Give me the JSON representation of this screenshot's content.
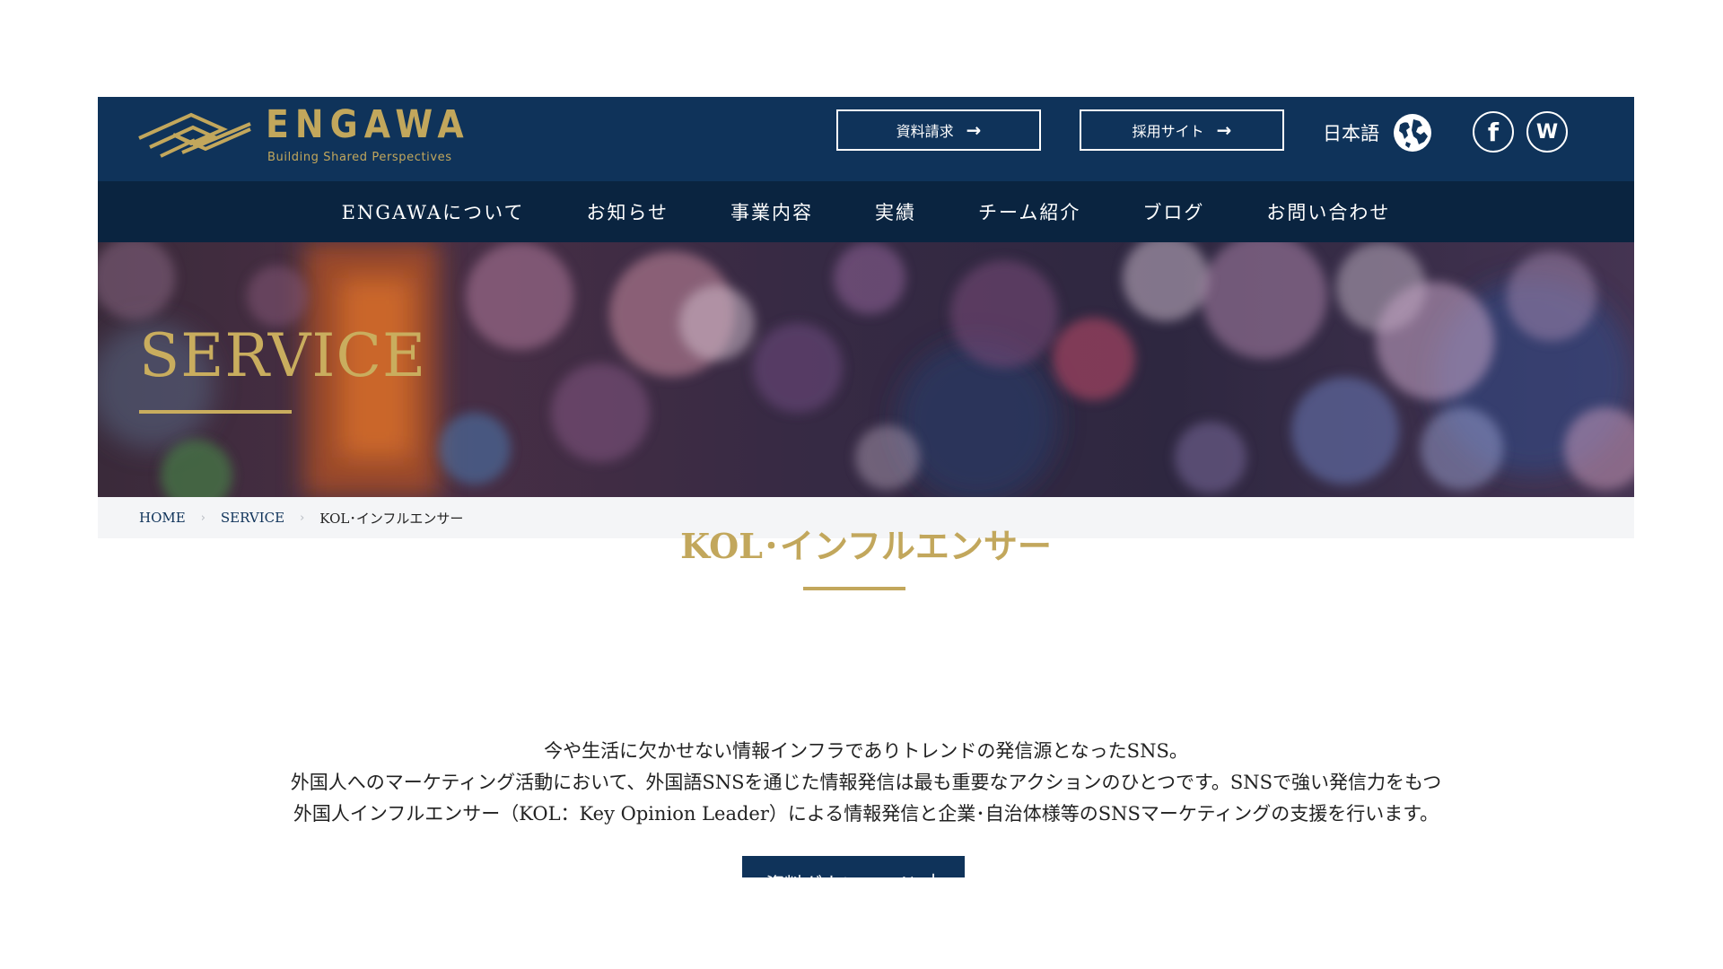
{
  "header": {
    "logo_name": "ENGAWA",
    "logo_tagline": "Building Shared Perspectives",
    "docs_button": "資料請求",
    "recruit_button": "採用サイト",
    "language": "日本語",
    "social": {
      "facebook": "f",
      "w": "W"
    }
  },
  "nav": {
    "items": [
      "ENGAWAについて",
      "お知らせ",
      "事業内容",
      "実績",
      "チーム紹介",
      "ブログ",
      "お問い合わせ"
    ]
  },
  "hero": {
    "title": "SERVICE"
  },
  "breadcrumb": {
    "home": "HOME",
    "service": "SERVICE",
    "current": "KOL･インフルエンサー"
  },
  "content": {
    "title": "KOL･インフルエンサー",
    "lead": [
      "今や生活に欠かせない情報インフラでありトレンドの発信源となったSNS。",
      "外国人へのマーケティング活動において、外国語SNSを通じた情報発信は最も重要なアクションのひとつです。SNSで強い発信力をもつ",
      "外国人インフルエンサー（KOL：Key Opinion Leader）による情報発信と企業･自治体様等のSNSマーケティングの支援を行います。"
    ],
    "download_button": "資料ダウンロード"
  },
  "colors": {
    "navy": "#0f335a",
    "nav_dark": "#0a2440",
    "gold": "#c2a75c"
  },
  "icons": {
    "arrow": "arrow-right-icon",
    "globe": "globe-icon",
    "download": "download-icon"
  }
}
